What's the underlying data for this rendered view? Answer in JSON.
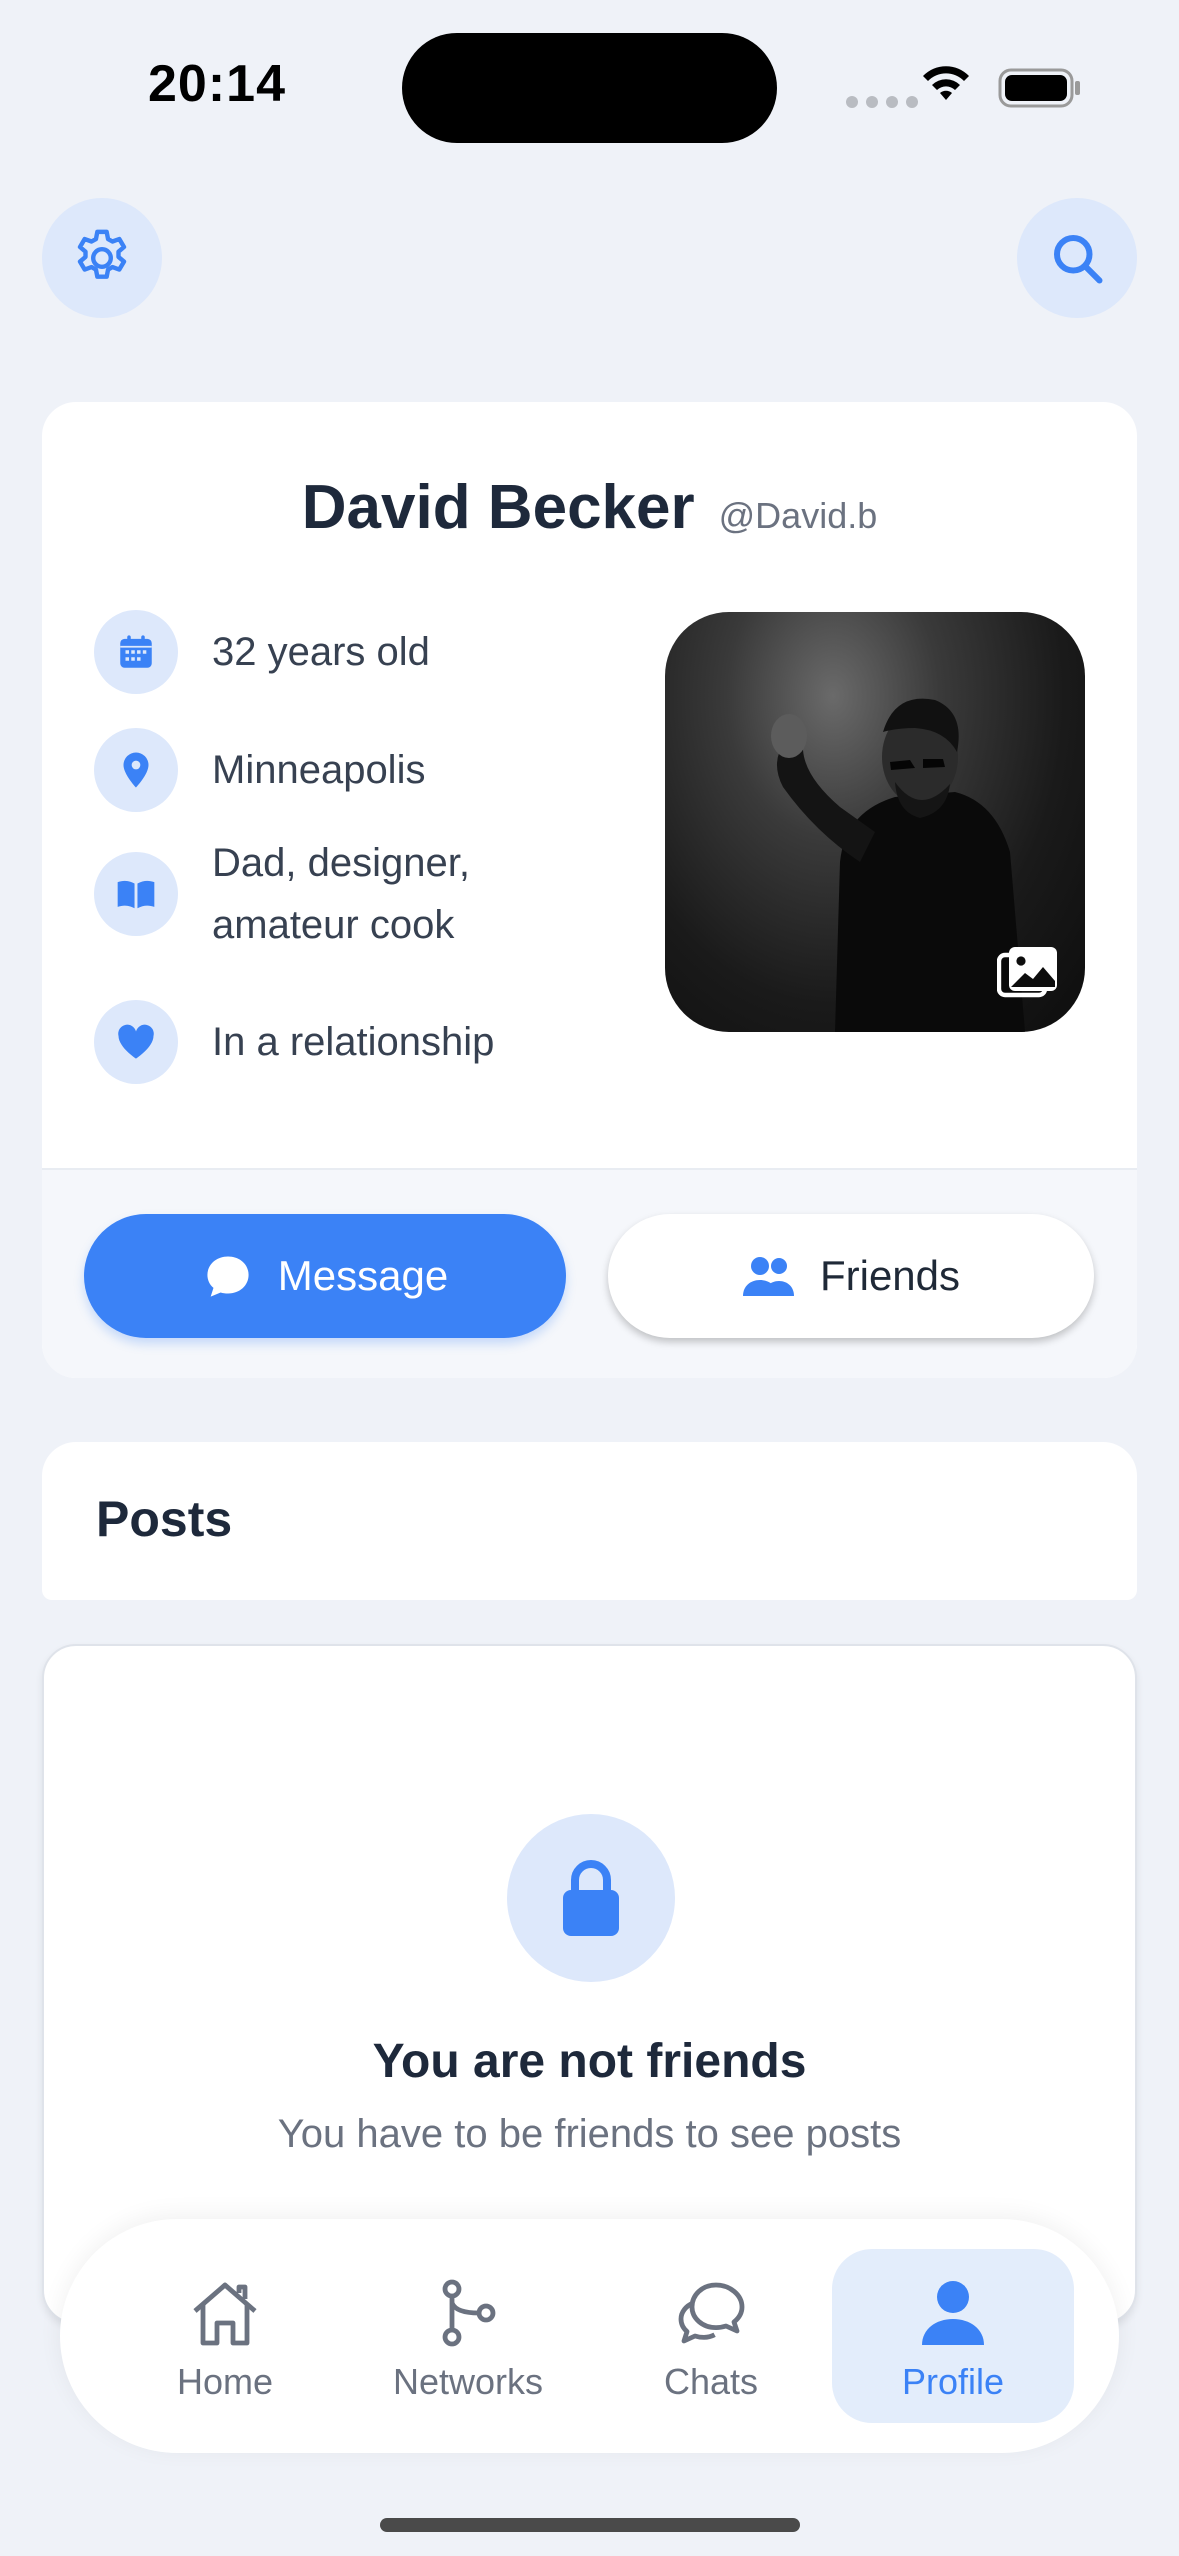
{
  "status_bar": {
    "time": "20:14"
  },
  "profile": {
    "name": "David Becker",
    "handle": "@David.b",
    "info": [
      {
        "icon": "calendar-icon",
        "text": "32 years old"
      },
      {
        "icon": "location-pin-icon",
        "text": "Minneapolis"
      },
      {
        "icon": "book-icon",
        "text": "Dad, designer, amateur cook"
      },
      {
        "icon": "heart-icon",
        "text": "In a relationship"
      }
    ],
    "actions": {
      "message_label": "Message",
      "friends_label": "Friends"
    }
  },
  "posts": {
    "title": "Posts",
    "locked_title": "You are not friends",
    "locked_subtitle": "You have to be friends to see posts"
  },
  "nav": {
    "items": [
      {
        "label": "Home",
        "icon": "home-icon"
      },
      {
        "label": "Networks",
        "icon": "network-icon"
      },
      {
        "label": "Chats",
        "icon": "chats-icon"
      },
      {
        "label": "Profile",
        "icon": "profile-icon",
        "active": true
      }
    ]
  },
  "colors": {
    "accent": "#3b82f6",
    "accent_light": "#dde8fb",
    "background": "#eff2f8"
  }
}
